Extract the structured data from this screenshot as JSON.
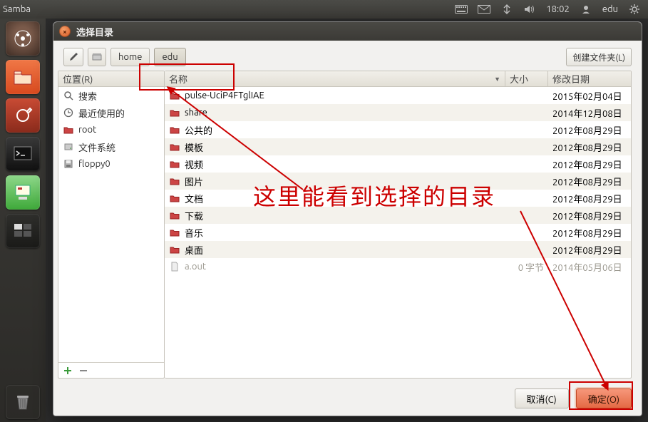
{
  "menubar": {
    "app": "Samba",
    "time": "18:02",
    "user": "edu"
  },
  "dialog_title": "选择目录",
  "toolbar": {
    "create_folder": "创建文件夹(L)",
    "crumbs": [
      "home",
      "edu"
    ]
  },
  "sidebar": {
    "header": "位置(R)",
    "items": [
      {
        "label": "搜索",
        "icon": "search"
      },
      {
        "label": "最近使用的",
        "icon": "recent"
      },
      {
        "label": "root",
        "icon": "folder-red"
      },
      {
        "label": "文件系统",
        "icon": "disk"
      },
      {
        "label": "floppy0",
        "icon": "floppy"
      }
    ]
  },
  "columns": {
    "name": "名称",
    "size": "大小",
    "date": "修改日期"
  },
  "rows": [
    {
      "name": "pulse-UciP4FTglIAE",
      "size": "",
      "date": "2015年02月04日",
      "type": "folder"
    },
    {
      "name": "share",
      "size": "",
      "date": "2014年12月08日",
      "type": "folder"
    },
    {
      "name": "公共的",
      "size": "",
      "date": "2012年08月29日",
      "type": "folder"
    },
    {
      "name": "模板",
      "size": "",
      "date": "2012年08月29日",
      "type": "folder"
    },
    {
      "name": "视频",
      "size": "",
      "date": "2012年08月29日",
      "type": "folder"
    },
    {
      "name": "图片",
      "size": "",
      "date": "2012年08月29日",
      "type": "folder"
    },
    {
      "name": "文档",
      "size": "",
      "date": "2012年08月29日",
      "type": "folder"
    },
    {
      "name": "下载",
      "size": "",
      "date": "2012年08月29日",
      "type": "folder"
    },
    {
      "name": "音乐",
      "size": "",
      "date": "2012年08月29日",
      "type": "folder"
    },
    {
      "name": "桌面",
      "size": "",
      "date": "2012年08月29日",
      "type": "folder"
    },
    {
      "name": "a.out",
      "size": "0 字节",
      "date": "2014年05月06日",
      "type": "file",
      "disabled": true
    }
  ],
  "footer": {
    "cancel": "取消(C)",
    "ok": "确定(O)"
  },
  "annotation_text": "这里能看到选择的目录"
}
